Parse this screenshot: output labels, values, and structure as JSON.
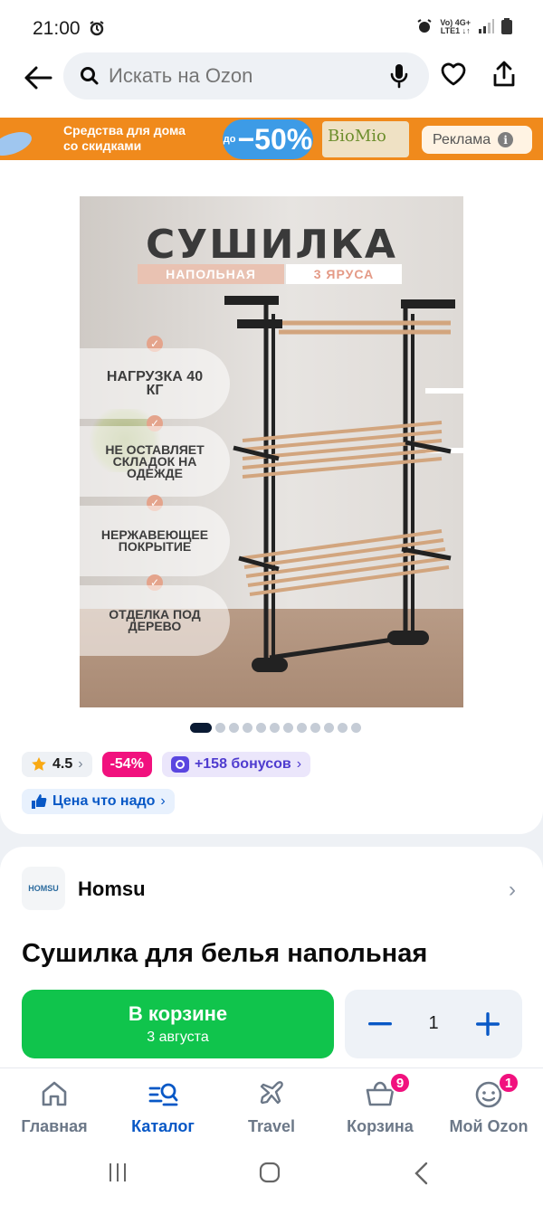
{
  "status_bar": {
    "time": "21:00",
    "network_line1": "Vo) 4G+",
    "network_line2": "LTE1 ↓↑"
  },
  "search": {
    "placeholder": "Искать на Ozon"
  },
  "banner": {
    "line1": "Средства для дома",
    "line2": "со скидками",
    "discount_prefix": "до",
    "discount": "−50%",
    "product_brand": "BioMio",
    "ad_label": "Реклама"
  },
  "product_image": {
    "title": "СУШИЛКА",
    "tag_type": "НАПОЛЬНАЯ",
    "tag_tiers": "3 ЯРУСА",
    "features": [
      "НАГРУЗКА 40 КГ",
      "НЕ ОСТАВЛЯЕТ СКЛАДОК НА ОДЕЖДЕ",
      "НЕРЖАВЕЮЩЕЕ ПОКРЫТИЕ",
      "ОТДЕЛКА ПОД ДЕРЕВО"
    ],
    "carousel_total": 12,
    "carousel_active": 1
  },
  "rating": {
    "value": "4.5"
  },
  "discount_badge": "-54%",
  "bonus": "+158 бонусов",
  "price_promo": "Цена что надо",
  "seller": {
    "name": "Homsu",
    "logo_text": "HOMSU"
  },
  "product": {
    "title": "Сушилка для белья напольная"
  },
  "cart": {
    "button_label": "В корзине",
    "delivery": "3 августа",
    "quantity": "1"
  },
  "tabs": [
    {
      "label": "Главная",
      "icon": "home-icon",
      "active": false
    },
    {
      "label": "Каталог",
      "icon": "catalog-search-icon",
      "active": true
    },
    {
      "label": "Travel",
      "icon": "airplane-icon",
      "active": false
    },
    {
      "label": "Корзина",
      "icon": "basket-icon",
      "active": false,
      "badge": "9"
    },
    {
      "label": "Мой Ozon",
      "icon": "profile-smile-icon",
      "active": false,
      "badge": "1"
    }
  ],
  "colors": {
    "ozon_blue": "#0858C6",
    "cart_green": "#10C44C",
    "discount_pink": "#F1117E",
    "banner_orange": "#F08A1C",
    "bonus_purple": "#4F3CCF"
  }
}
